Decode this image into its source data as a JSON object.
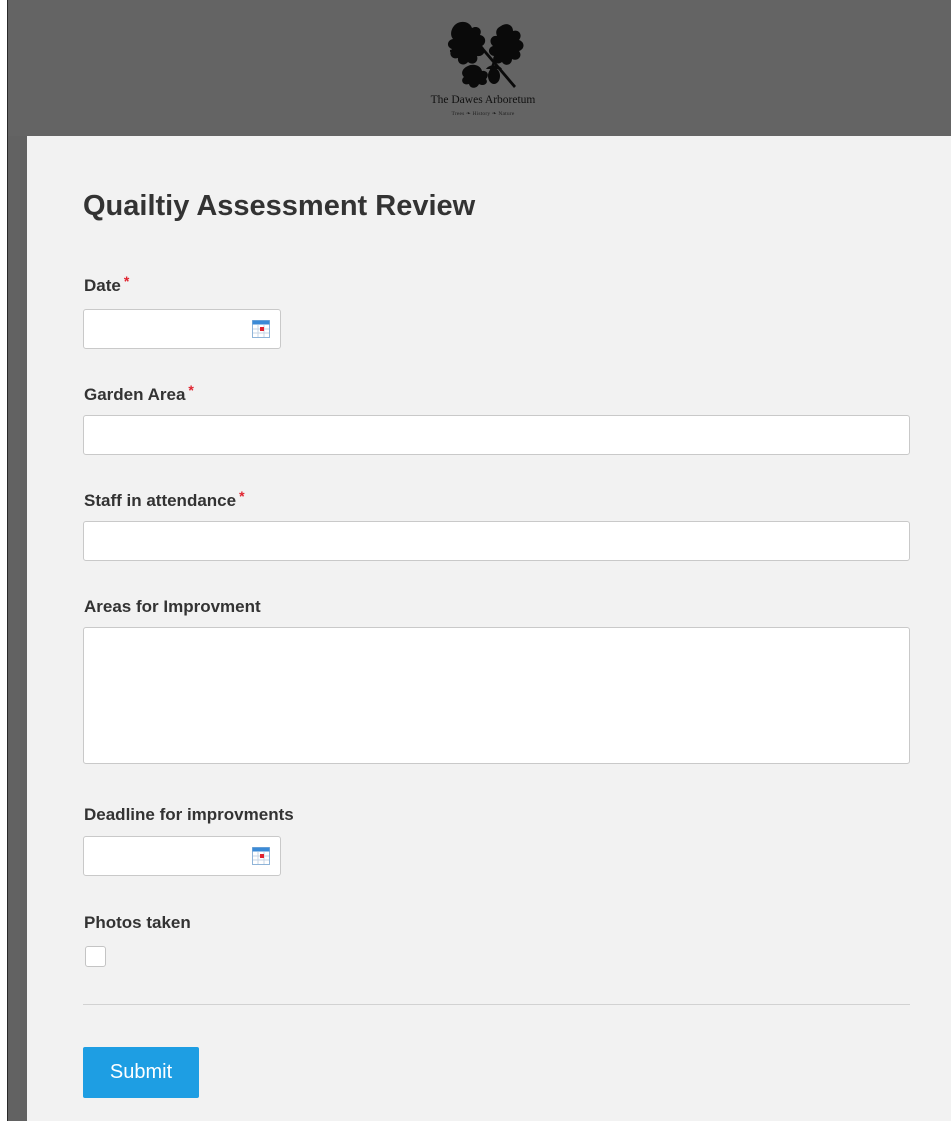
{
  "header": {
    "logo_name": "The Dawes Arboretum",
    "logo_tagline": "Trees ❧ History ❧ Nature"
  },
  "form": {
    "title": "Quailtiy Assessment Review",
    "required_marker": "*",
    "fields": {
      "date": {
        "label": "Date",
        "value": "",
        "required": true
      },
      "garden_area": {
        "label": "Garden Area",
        "value": "",
        "required": true
      },
      "staff": {
        "label": "Staff in attendance",
        "value": "",
        "required": true
      },
      "improvements": {
        "label": "Areas for Improvment",
        "value": "",
        "required": false
      },
      "deadline": {
        "label": "Deadline for improvments",
        "value": "",
        "required": false
      },
      "photos": {
        "label": "Photos taken",
        "checked": false,
        "required": false
      }
    },
    "submit_label": "Submit"
  },
  "colors": {
    "header_bg": "#646464",
    "panel_bg": "#f2f2f2",
    "required": "#e0232f",
    "button": "#1e9ee3",
    "text": "#333333"
  },
  "icons": {
    "logo": "oak-leaves-logo",
    "date_picker": "calendar-icon"
  }
}
